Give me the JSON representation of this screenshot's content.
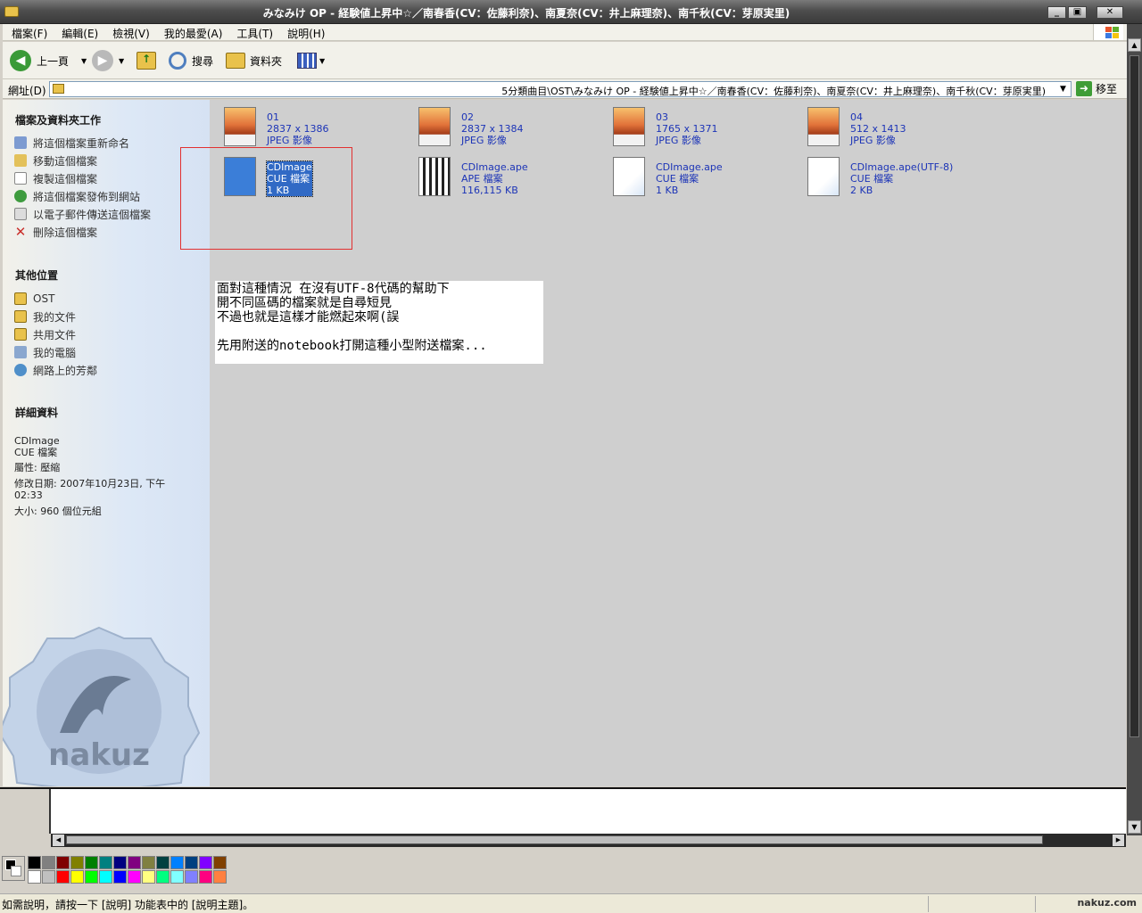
{
  "window": {
    "title": "みなみけ OP - 経験値上昇中☆／南春香(CV：佐藤利奈)、南夏奈(CV：井上麻理奈)、南千秋(CV：芽原実里)"
  },
  "menu": [
    "檔案(F)",
    "編輯(E)",
    "檢視(V)",
    "我的最愛(A)",
    "工具(T)",
    "說明(H)"
  ],
  "toolbar": {
    "back_label": "上一頁",
    "search_label": "搜尋",
    "folders_label": "資料夾"
  },
  "address": {
    "label": "網址(D)",
    "path": "5分類曲目\\OST\\みなみけ OP - 経験値上昇中☆／南春香(CV：佐藤利奈)、南夏奈(CV：井上麻理奈)、南千秋(CV：芽原実里)",
    "go_label": "移至"
  },
  "sidebar": {
    "tasks_title": "檔案及資料夾工作",
    "tasks": [
      "將這個檔案重新命名",
      "移動這個檔案",
      "複製這個檔案",
      "將這個檔案發佈到網站",
      "以電子郵件傳送這個檔案",
      "刪除這個檔案"
    ],
    "other_title": "其他位置",
    "other": [
      "OST",
      "我的文件",
      "共用文件",
      "我的電腦",
      "網路上的芳鄰"
    ],
    "details_title": "詳細資料",
    "details": {
      "name": "CDImage",
      "type": "CUE 檔案",
      "attr": "屬性: 壓縮",
      "modified": "修改日期: 2007年10月23日, 下午",
      "modified_time": "02:33",
      "size": "大小: 960 個位元組"
    },
    "badge_text": "nakuz"
  },
  "files": [
    {
      "name": "01",
      "line2": "2837 x 1386",
      "line3": "JPEG 影像",
      "kind": "jpeg"
    },
    {
      "name": "02",
      "line2": "2837 x 1384",
      "line3": "JPEG 影像",
      "kind": "jpeg"
    },
    {
      "name": "03",
      "line2": "1765 x 1371",
      "line3": "JPEG 影像",
      "kind": "jpeg"
    },
    {
      "name": "04",
      "line2": "512 x 1413",
      "line3": "JPEG 影像",
      "kind": "jpeg"
    },
    {
      "name": "CDImage",
      "line2": "CUE 檔案",
      "line3": "1 KB",
      "kind": "cue-selected"
    },
    {
      "name": "CDImage.ape",
      "line2": "APE 檔案",
      "line3": "116,115 KB",
      "kind": "ape"
    },
    {
      "name": "CDImage.ape",
      "line2": "CUE 檔案",
      "line3": "1 KB",
      "kind": "cue"
    },
    {
      "name": "CDImage.ape(UTF-8)",
      "line2": "CUE 檔案",
      "line3": "2 KB",
      "kind": "cue"
    }
  ],
  "note": {
    "line1": "面對這種情況 在沒有UTF-8代碼的幫助下",
    "line2": "開不同區碼的檔案就是自尋短見",
    "line3": "不過也就是這樣才能燃起來啊(誤",
    "line4": "先用附送的notebook打開這種小型附送檔案..."
  },
  "palette": [
    "#000000",
    "#808080",
    "#800000",
    "#808000",
    "#008000",
    "#008080",
    "#000080",
    "#800080",
    "#808040",
    "#004040",
    "#0080ff",
    "#004080",
    "#8000ff",
    "#804000",
    "#ffffff",
    "#c0c0c0",
    "#ff0000",
    "#ffff00",
    "#00ff00",
    "#00ffff",
    "#0000ff",
    "#ff00ff",
    "#ffff80",
    "#00ff80",
    "#80ffff",
    "#8080ff",
    "#ff0080",
    "#ff8040"
  ],
  "status": {
    "text": "如需說明，請按一下 [說明] 功能表中的 [說明主題]。",
    "brand": "nakuz.com"
  }
}
